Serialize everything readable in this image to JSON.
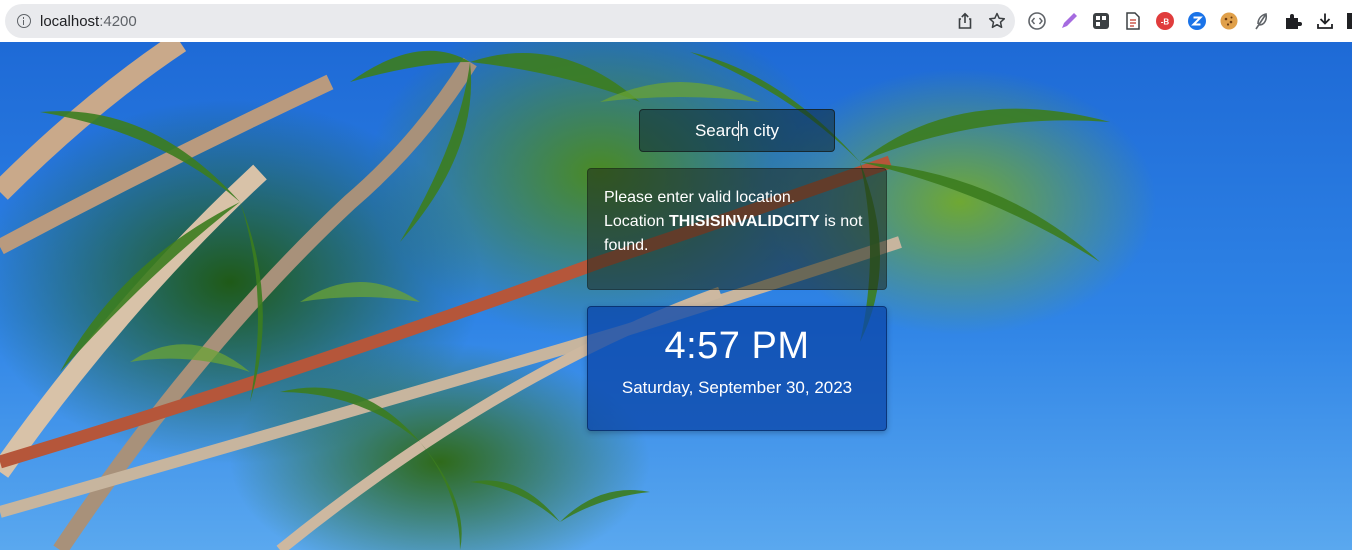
{
  "browser": {
    "url_host": "localhost",
    "url_port": ":4200",
    "icons": [
      "info-icon",
      "share-icon",
      "bookmark-star-icon",
      "extension-icons",
      "extensions-puzzle-icon",
      "download-icon"
    ]
  },
  "search": {
    "value": "",
    "placeholder": "Search city"
  },
  "error": {
    "line1": "Please enter valid location.",
    "prefix": "Location",
    "city": "THISISINVALIDCITY",
    "suffix": "is not found."
  },
  "clock": {
    "time": "4:57 PM",
    "date": "Saturday, September 30, 2023"
  },
  "colors": {
    "time_card_bg": "#0c48aa",
    "sky_blue": "#1e6ad6"
  }
}
